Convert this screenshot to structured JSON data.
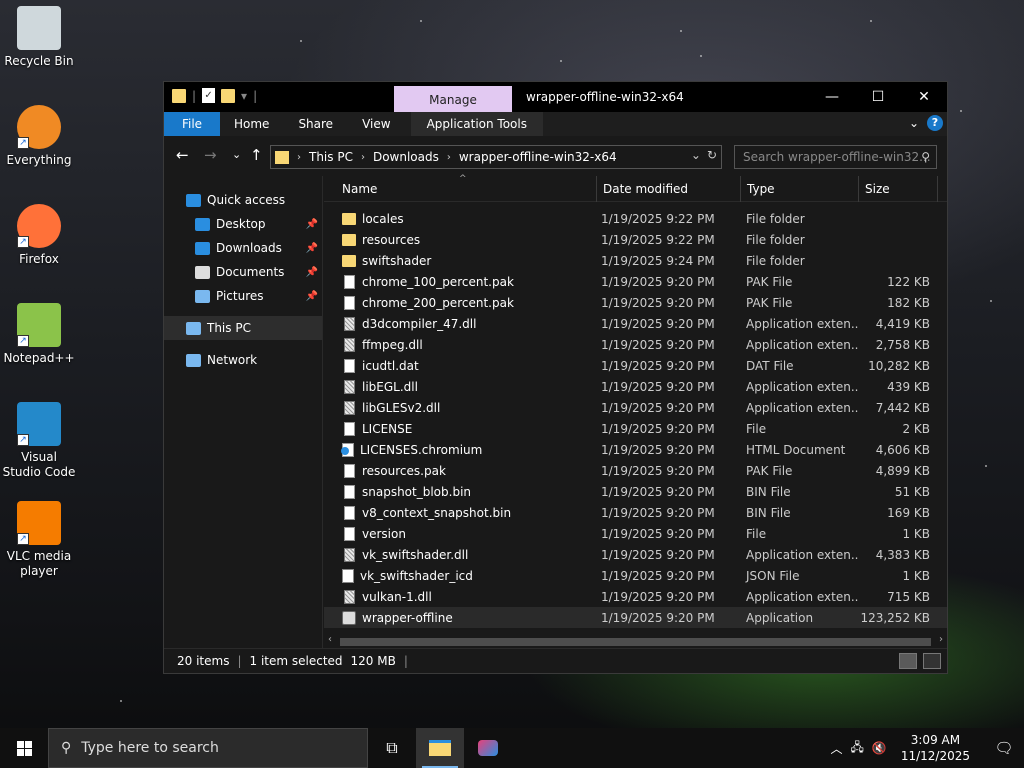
{
  "desktop": {
    "icons": [
      {
        "label": "Recycle Bin",
        "icon": "recycle-bin-icon"
      },
      {
        "label": "Everything",
        "icon": "everything-search-icon"
      },
      {
        "label": "Firefox",
        "icon": "firefox-icon"
      },
      {
        "label": "Notepad++",
        "icon": "notepad-plus-plus-icon"
      },
      {
        "label": "Visual Studio Code",
        "icon": "vscode-icon"
      },
      {
        "label": "VLC media player",
        "icon": "vlc-icon"
      }
    ]
  },
  "window": {
    "manage_tab": "Manage",
    "title": "wrapper-offline-win32-x64",
    "ribbon_tabs": [
      "File",
      "Home",
      "Share",
      "View",
      "Application Tools"
    ],
    "address": [
      "This PC",
      "Downloads",
      "wrapper-offline-win32-x64"
    ],
    "search_placeholder": "Search wrapper-offline-win32...",
    "sidebar": [
      {
        "label": "Quick access",
        "icon": "star-icon",
        "pinned": false
      },
      {
        "label": "Desktop",
        "icon": "desktop-icon",
        "pinned": true
      },
      {
        "label": "Downloads",
        "icon": "download-icon",
        "pinned": true
      },
      {
        "label": "Documents",
        "icon": "documents-icon",
        "pinned": true
      },
      {
        "label": "Pictures",
        "icon": "pictures-icon",
        "pinned": true
      },
      {
        "label": "This PC",
        "icon": "computer-icon",
        "pinned": false
      },
      {
        "label": "Network",
        "icon": "network-icon",
        "pinned": false
      }
    ],
    "columns": [
      "Name",
      "Date modified",
      "Type",
      "Size"
    ],
    "files": [
      {
        "name": "locales",
        "date": "1/19/2025 9:22 PM",
        "type": "File folder",
        "size": "",
        "kind": "folder"
      },
      {
        "name": "resources",
        "date": "1/19/2025 9:22 PM",
        "type": "File folder",
        "size": "",
        "kind": "folder"
      },
      {
        "name": "swiftshader",
        "date": "1/19/2025 9:24 PM",
        "type": "File folder",
        "size": "",
        "kind": "folder"
      },
      {
        "name": "chrome_100_percent.pak",
        "date": "1/19/2025 9:20 PM",
        "type": "PAK File",
        "size": "122 KB",
        "kind": "file"
      },
      {
        "name": "chrome_200_percent.pak",
        "date": "1/19/2025 9:20 PM",
        "type": "PAK File",
        "size": "182 KB",
        "kind": "file"
      },
      {
        "name": "d3dcompiler_47.dll",
        "date": "1/19/2025 9:20 PM",
        "type": "Application exten...",
        "size": "4,419 KB",
        "kind": "dll"
      },
      {
        "name": "ffmpeg.dll",
        "date": "1/19/2025 9:20 PM",
        "type": "Application exten...",
        "size": "2,758 KB",
        "kind": "dll"
      },
      {
        "name": "icudtl.dat",
        "date": "1/19/2025 9:20 PM",
        "type": "DAT File",
        "size": "10,282 KB",
        "kind": "file"
      },
      {
        "name": "libEGL.dll",
        "date": "1/19/2025 9:20 PM",
        "type": "Application exten...",
        "size": "439 KB",
        "kind": "dll"
      },
      {
        "name": "libGLESv2.dll",
        "date": "1/19/2025 9:20 PM",
        "type": "Application exten...",
        "size": "7,442 KB",
        "kind": "dll"
      },
      {
        "name": "LICENSE",
        "date": "1/19/2025 9:20 PM",
        "type": "File",
        "size": "2 KB",
        "kind": "file"
      },
      {
        "name": "LICENSES.chromium",
        "date": "1/19/2025 9:20 PM",
        "type": "HTML Document",
        "size": "4,606 KB",
        "kind": "html"
      },
      {
        "name": "resources.pak",
        "date": "1/19/2025 9:20 PM",
        "type": "PAK File",
        "size": "4,899 KB",
        "kind": "file"
      },
      {
        "name": "snapshot_blob.bin",
        "date": "1/19/2025 9:20 PM",
        "type": "BIN File",
        "size": "51 KB",
        "kind": "file"
      },
      {
        "name": "v8_context_snapshot.bin",
        "date": "1/19/2025 9:20 PM",
        "type": "BIN File",
        "size": "169 KB",
        "kind": "file"
      },
      {
        "name": "version",
        "date": "1/19/2025 9:20 PM",
        "type": "File",
        "size": "1 KB",
        "kind": "file"
      },
      {
        "name": "vk_swiftshader.dll",
        "date": "1/19/2025 9:20 PM",
        "type": "Application exten...",
        "size": "4,383 KB",
        "kind": "dll"
      },
      {
        "name": "vk_swiftshader_icd",
        "date": "1/19/2025 9:20 PM",
        "type": "JSON File",
        "size": "1 KB",
        "kind": "json"
      },
      {
        "name": "vulkan-1.dll",
        "date": "1/19/2025 9:20 PM",
        "type": "Application exten...",
        "size": "715 KB",
        "kind": "dll"
      },
      {
        "name": "wrapper-offline",
        "date": "1/19/2025 9:20 PM",
        "type": "Application",
        "size": "123,252 KB",
        "kind": "app",
        "selected": true
      }
    ],
    "status": {
      "items": "20 items",
      "selected": "1 item selected",
      "size": "120 MB"
    }
  },
  "taskbar": {
    "search_placeholder": "Type here to search",
    "time": "3:09 AM",
    "date": "11/12/2025"
  },
  "colors": {
    "accent": "#1979ca",
    "manage_tab": "#e2c9f2",
    "folder": "#f8d775"
  }
}
